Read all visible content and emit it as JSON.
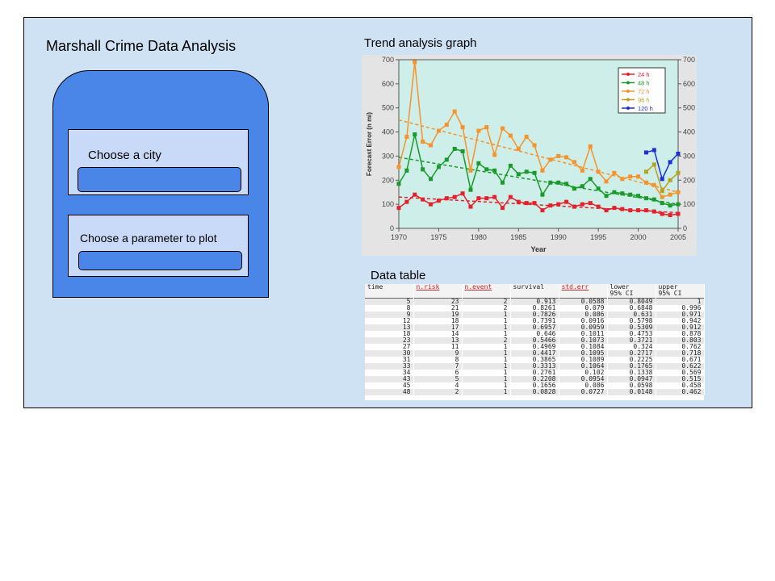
{
  "app": {
    "title": "Marshall Crime Data Analysis"
  },
  "controls": {
    "city_label": "Choose a city",
    "city_value": "",
    "param_label": "Choose a parameter to plot",
    "param_value": ""
  },
  "trend": {
    "title": "Trend analysis graph"
  },
  "table": {
    "title": "Data table",
    "columns": [
      "time",
      "n.risk",
      "n.event",
      "survival",
      "std.err",
      "lower\n95% CI",
      "upper\n95% CI"
    ],
    "rows": [
      [
        "5",
        "23",
        "2",
        "0.913",
        "0.0588",
        "0.8049",
        "1"
      ],
      [
        "8",
        "21",
        "2",
        "0.8261",
        "0.079",
        "0.6848",
        "0.996"
      ],
      [
        "9",
        "19",
        "1",
        "0.7826",
        "0.086",
        "0.631",
        "0.971"
      ],
      [
        "12",
        "18",
        "1",
        "0.7391",
        "0.0916",
        "0.5798",
        "0.942"
      ],
      [
        "13",
        "17",
        "1",
        "0.6957",
        "0.0959",
        "0.5309",
        "0.912"
      ],
      [
        "18",
        "14",
        "1",
        "0.646",
        "0.1011",
        "0.4753",
        "0.878"
      ],
      [
        "23",
        "13",
        "2",
        "0.5466",
        "0.1073",
        "0.3721",
        "0.803"
      ],
      [
        "27",
        "11",
        "1",
        "0.4969",
        "0.1084",
        "0.324",
        "0.762"
      ],
      [
        "30",
        "9",
        "1",
        "0.4417",
        "0.1095",
        "0.2717",
        "0.718"
      ],
      [
        "31",
        "8",
        "1",
        "0.3865",
        "0.1089",
        "0.2225",
        "0.671"
      ],
      [
        "33",
        "7",
        "1",
        "0.3313",
        "0.1064",
        "0.1765",
        "0.622"
      ],
      [
        "34",
        "6",
        "1",
        "0.2761",
        "0.102",
        "0.1338",
        "0.569"
      ],
      [
        "43",
        "5",
        "1",
        "0.2208",
        "0.0954",
        "0.0947",
        "0.515"
      ],
      [
        "45",
        "4",
        "1",
        "0.1656",
        "0.086",
        "0.0598",
        "0.458"
      ],
      [
        "48",
        "2",
        "1",
        "0.0828",
        "0.0727",
        "0.0148",
        "0.462"
      ]
    ]
  },
  "chart_data": {
    "type": "line",
    "title": "",
    "xlabel": "Year",
    "ylabel": "Forecast Error (n mi)",
    "xlim": [
      1970,
      2005
    ],
    "ylim": [
      0,
      700
    ],
    "x_ticks": [
      1970,
      1975,
      1980,
      1985,
      1990,
      1995,
      2000,
      2005
    ],
    "y_ticks": [
      0,
      100,
      200,
      300,
      400,
      500,
      600,
      700
    ],
    "grid": false,
    "legend_position": "top-right",
    "background": "#cdeee9",
    "series": [
      {
        "name": "24 h",
        "color": "#e8202a",
        "x": [
          1970,
          1971,
          1972,
          1973,
          1974,
          1975,
          1976,
          1977,
          1978,
          1979,
          1980,
          1981,
          1982,
          1983,
          1984,
          1985,
          1986,
          1987,
          1988,
          1989,
          1990,
          1991,
          1992,
          1993,
          1994,
          1995,
          1996,
          1997,
          1998,
          1999,
          2000,
          2001,
          2002,
          2003,
          2004,
          2005
        ],
        "values": [
          85,
          110,
          140,
          120,
          100,
          115,
          125,
          130,
          145,
          90,
          125,
          125,
          130,
          85,
          130,
          110,
          105,
          105,
          75,
          95,
          100,
          110,
          90,
          100,
          105,
          90,
          75,
          85,
          80,
          75,
          75,
          75,
          70,
          60,
          55,
          60
        ],
        "trend": [
          130,
          65
        ]
      },
      {
        "name": "48 h",
        "color": "#1a9a2a",
        "x": [
          1970,
          1971,
          1972,
          1973,
          1974,
          1975,
          1976,
          1977,
          1978,
          1979,
          1980,
          1981,
          1982,
          1983,
          1984,
          1985,
          1986,
          1987,
          1988,
          1989,
          1990,
          1991,
          1992,
          1993,
          1994,
          1995,
          1996,
          1997,
          1998,
          1999,
          2000,
          2001,
          2002,
          2003,
          2004,
          2005
        ],
        "values": [
          185,
          240,
          390,
          245,
          205,
          255,
          285,
          330,
          320,
          160,
          270,
          245,
          240,
          190,
          260,
          225,
          235,
          230,
          140,
          190,
          190,
          185,
          165,
          175,
          205,
          165,
          135,
          150,
          145,
          140,
          135,
          125,
          120,
          105,
          95,
          100
        ],
        "trend": [
          295,
          100
        ]
      },
      {
        "name": "72 h",
        "color": "#f7932a",
        "x": [
          1970,
          1971,
          1972,
          1973,
          1974,
          1975,
          1976,
          1977,
          1978,
          1979,
          1980,
          1981,
          1982,
          1983,
          1984,
          1985,
          1986,
          1987,
          1988,
          1989,
          1990,
          1991,
          1992,
          1993,
          1994,
          1995,
          1996,
          1997,
          1998,
          1999,
          2000,
          2001,
          2002,
          2003,
          2004,
          2005
        ],
        "values": [
          255,
          380,
          690,
          360,
          345,
          405,
          430,
          485,
          420,
          240,
          405,
          420,
          305,
          415,
          385,
          330,
          380,
          345,
          240,
          285,
          300,
          295,
          275,
          240,
          340,
          235,
          195,
          230,
          205,
          215,
          215,
          190,
          180,
          130,
          140,
          150
        ],
        "trend": [
          450,
          150
        ]
      },
      {
        "name": "96 h",
        "color": "#b8a020",
        "x": [
          2001,
          2002,
          2003,
          2004,
          2005
        ],
        "values": [
          235,
          265,
          155,
          200,
          230
        ]
      },
      {
        "name": "120 h",
        "color": "#1c2fd8",
        "x": [
          2001,
          2002,
          2003,
          2004,
          2005
        ],
        "values": [
          315,
          325,
          205,
          275,
          310
        ]
      }
    ]
  }
}
